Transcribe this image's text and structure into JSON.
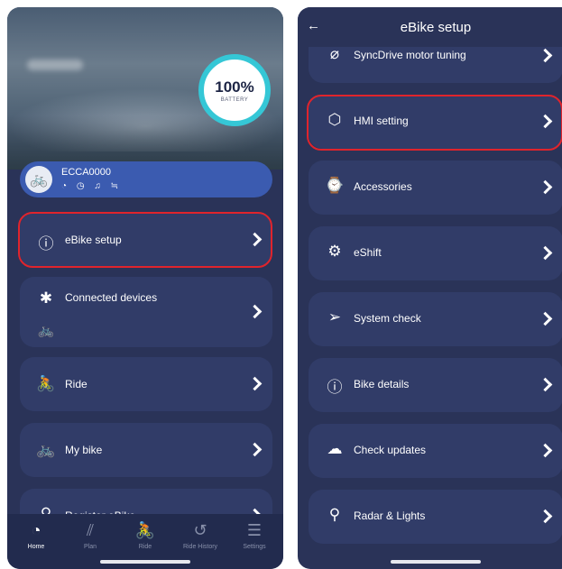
{
  "left": {
    "user_name": "",
    "battery": {
      "percent": "100%",
      "label": "BATTERY"
    },
    "bike": {
      "name": "ECCA0000",
      "status_icons": "◔ ◷ ♫ ≒"
    },
    "menu": [
      {
        "label": "eBike setup",
        "icon": "ⓘ"
      },
      {
        "label": "Connected devices",
        "icon": "✱",
        "sub_icon": "🚲"
      },
      {
        "label": "Ride",
        "icon": "🚴"
      },
      {
        "label": "My bike",
        "icon": "🚲"
      },
      {
        "label": "Register eBike",
        "icon": "⚲"
      }
    ],
    "tabs": [
      {
        "label": "Home",
        "icon": "◔"
      },
      {
        "label": "Plan",
        "icon": "⫽"
      },
      {
        "label": "Ride",
        "icon": "🚴"
      },
      {
        "label": "Ride History",
        "icon": "↺"
      },
      {
        "label": "Settings",
        "icon": "☰"
      }
    ]
  },
  "right": {
    "back_icon": "←",
    "title": "eBike setup",
    "items": [
      {
        "label": "SyncDrive motor tuning",
        "icon": "⌀"
      },
      {
        "label": "HMI setting",
        "icon": "⬡"
      },
      {
        "label": "Accessories",
        "icon": "⌚"
      },
      {
        "label": "eShift",
        "icon": "⚙"
      },
      {
        "label": "System check",
        "icon": "➢"
      },
      {
        "label": "Bike details",
        "icon": "ⓘ"
      },
      {
        "label": "Check updates",
        "icon": "☁"
      },
      {
        "label": "Radar & Lights",
        "icon": "⚲"
      }
    ]
  },
  "colors": {
    "background": "#2a3358",
    "card": "#313c68",
    "highlight": "#e0242c",
    "battery_ring": "#35c7d6",
    "bike_card": "#3b5bb0"
  }
}
